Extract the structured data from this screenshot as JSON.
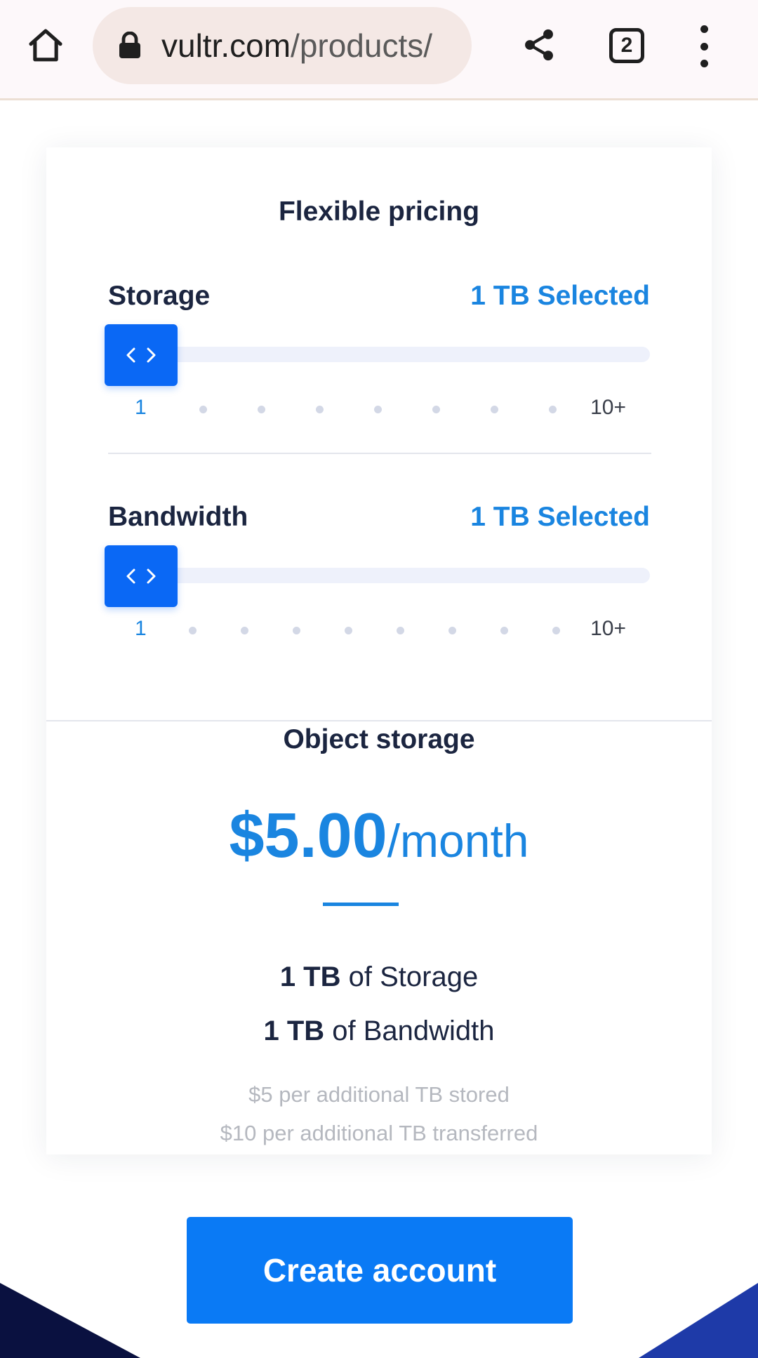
{
  "browser": {
    "url_host": "vultr.com",
    "url_path": "/products/",
    "tab_count": "2",
    "icons": [
      "home-icon",
      "lock-icon",
      "share-icon",
      "tabs-icon",
      "more-vert-icon"
    ]
  },
  "pricing": {
    "title": "Flexible pricing",
    "storage": {
      "label": "Storage",
      "selected_text": "1 TB Selected",
      "min_label": "1",
      "max_label": "10+",
      "value_tb": 1,
      "thumb_icon": "code-chevrons-icon"
    },
    "bandwidth": {
      "label": "Bandwidth",
      "selected_text": "1 TB Selected",
      "min_label": "1",
      "max_label": "10+",
      "value_tb": 1,
      "thumb_icon": "code-chevrons-icon"
    }
  },
  "plan": {
    "title": "Object storage",
    "price": "$5.00",
    "period": "/month",
    "storage_amount": "1 TB",
    "storage_suffix": " of Storage",
    "bandwidth_amount": "1 TB",
    "bandwidth_suffix": " of Bandwidth",
    "note_storage": "$5 per additional TB stored",
    "note_transfer": "$10 per additional TB transferred"
  },
  "cta": {
    "label": "Create account"
  },
  "colors": {
    "accent": "#1a85e0",
    "button": "#0a7af5",
    "thumb": "#0a68f5",
    "heading": "#1b2540",
    "muted": "#b5b8bf",
    "footer_dark": "#0a1140",
    "footer_blue": "#1e3aa8"
  }
}
